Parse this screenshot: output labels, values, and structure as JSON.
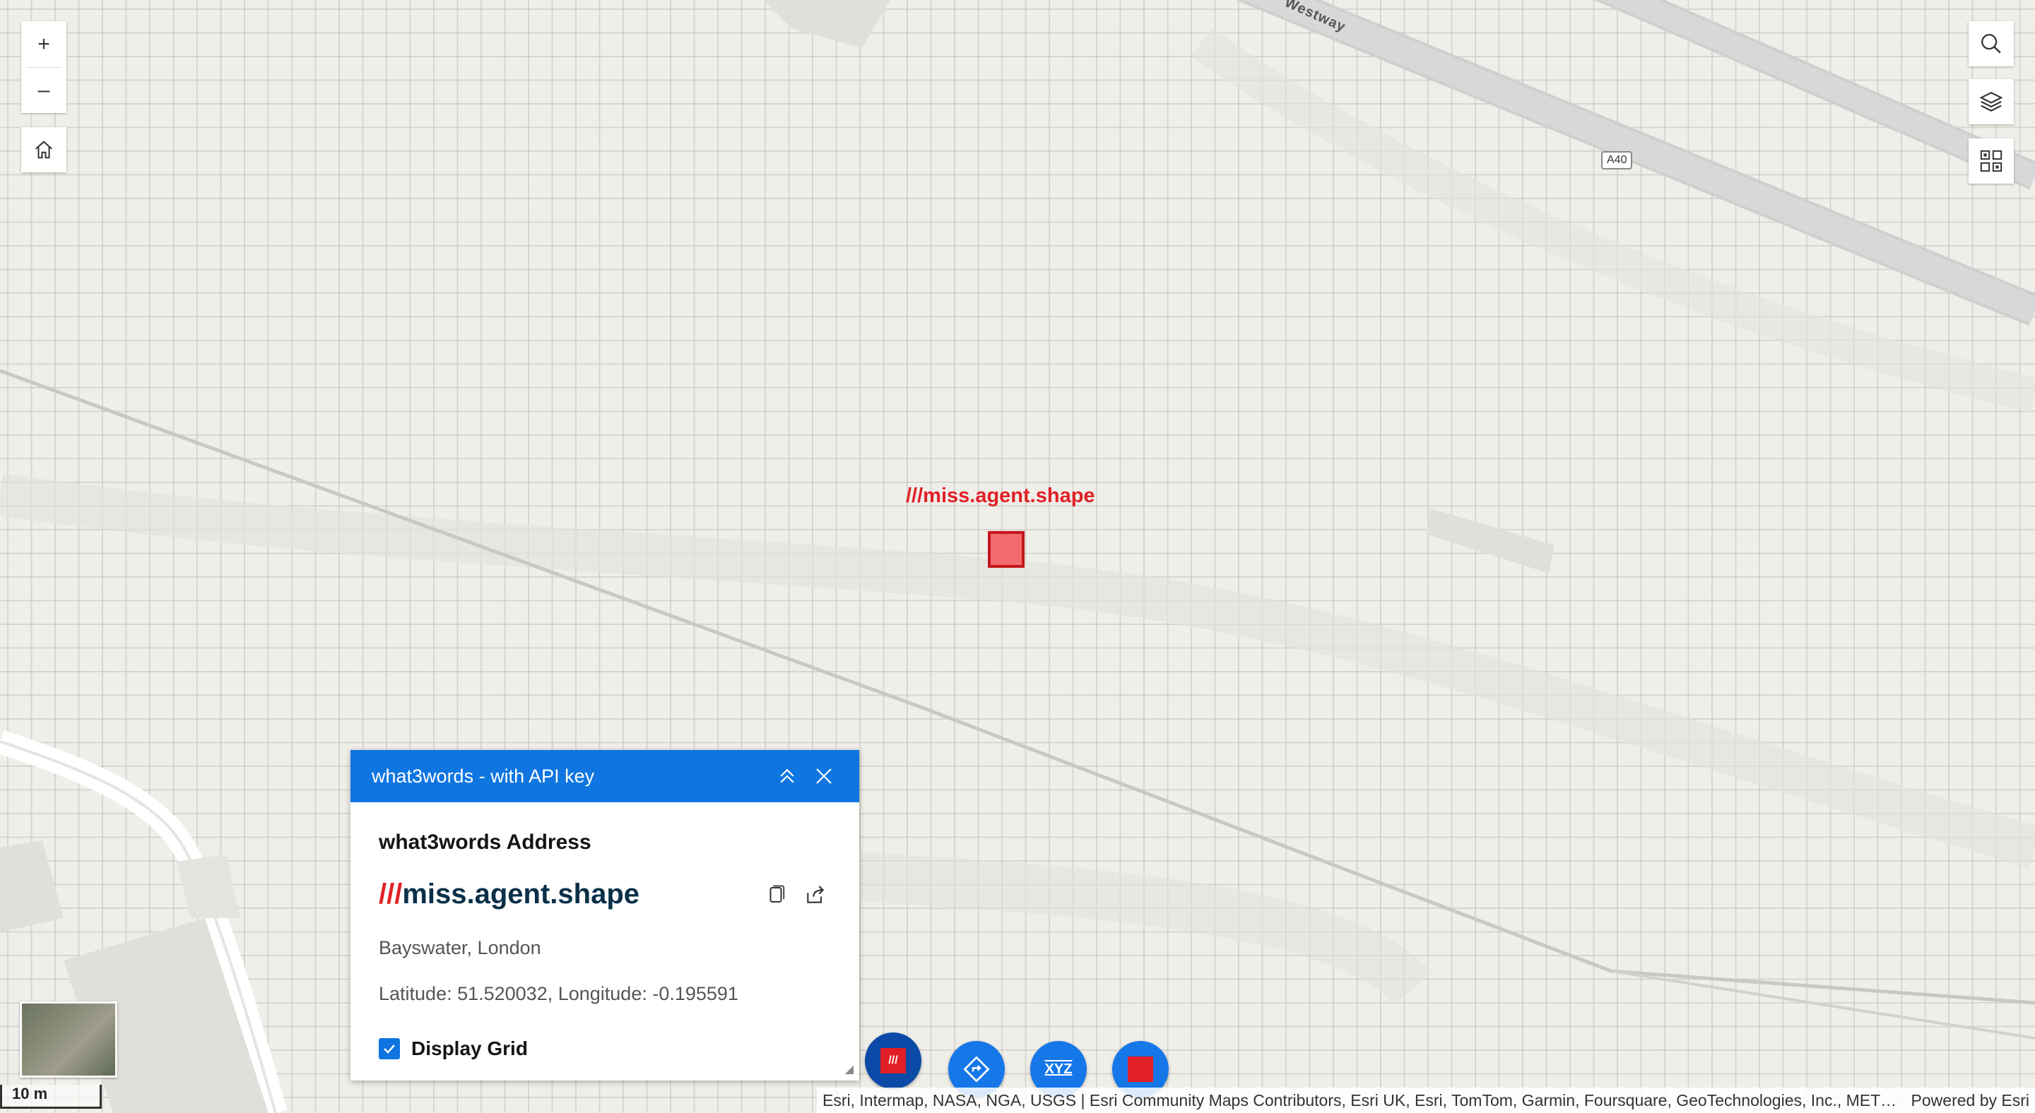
{
  "map": {
    "road_label": "Westway",
    "shield_label": "A40",
    "w3w_label": "///miss.agent.shape",
    "marker_color": "#f26a6e"
  },
  "controls": {
    "zoom_in": "+",
    "zoom_out": "–",
    "home_icon": "home-icon",
    "search_icon": "search-icon",
    "layers_icon": "layers-icon",
    "grid_icon": "grid-icon"
  },
  "panel": {
    "title": "what3words - with API key",
    "heading": "what3words Address",
    "address_slashes": "///",
    "address_words": "miss.agent.shape",
    "location": "Bayswater, London",
    "coordinates": "Latitude: 51.520032, Longitude: -0.195591",
    "display_grid_label": "Display Grid",
    "display_grid_checked": true,
    "header_color": "#0f75e0"
  },
  "toolbar": {
    "w3w_button_text": "///",
    "coord_button_text": "XYZ"
  },
  "scale": {
    "label": "10 m"
  },
  "attribution": {
    "text": "Esri, Intermap, NASA, NGA, USGS | Esri Community Maps Contributors, Esri UK, Esri, TomTom, Garmin, Foursquare, GeoTechnologies, Inc., METI/NASA, USGS",
    "powered": "Powered by Esri"
  },
  "colors": {
    "accent": "#0f75e0",
    "w3w_red": "#e11f26"
  }
}
